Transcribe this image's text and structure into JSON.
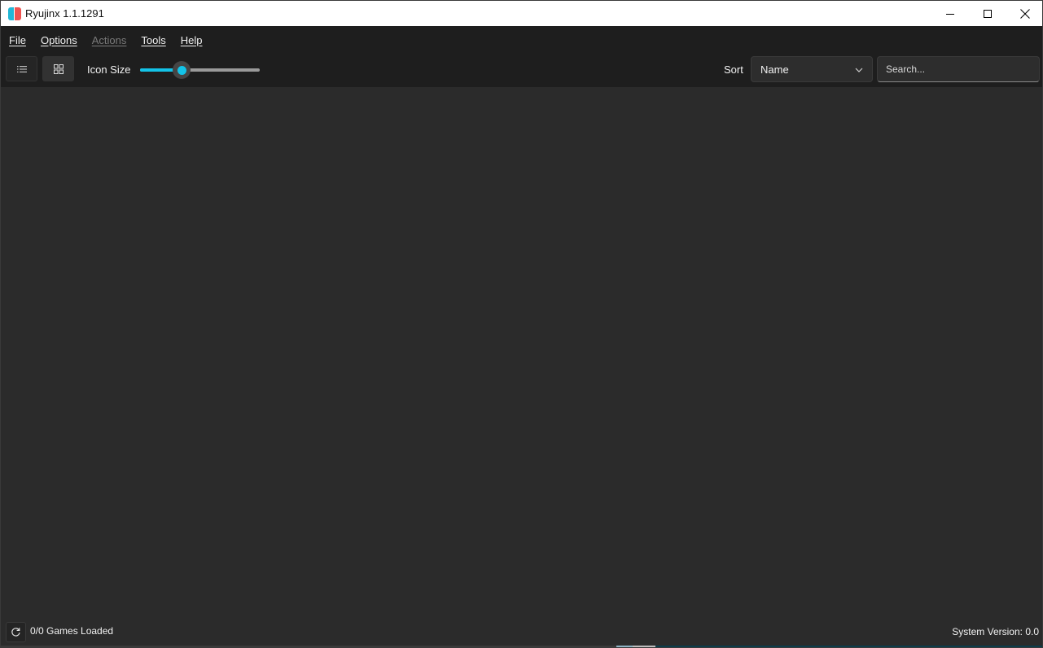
{
  "window": {
    "title": "Ryujinx 1.1.1291"
  },
  "menu": {
    "items": [
      {
        "label": "File",
        "enabled": true
      },
      {
        "label": "Options",
        "enabled": true
      },
      {
        "label": "Actions",
        "enabled": false
      },
      {
        "label": "Tools",
        "enabled": true
      },
      {
        "label": "Help",
        "enabled": true
      }
    ]
  },
  "toolbar": {
    "list_view_icon": "list-icon",
    "grid_view_icon": "grid-icon",
    "icon_size_label": "Icon Size",
    "icon_size_fraction": 0.35,
    "sort_label": "Sort",
    "sort_value": "Name",
    "search_placeholder": "Search...",
    "search_value": ""
  },
  "status": {
    "refresh_icon": "refresh-icon",
    "games_loaded": "0/0 Games Loaded",
    "system_version": "System Version: 0.0"
  },
  "colors": {
    "accent": "#13c3e8",
    "background": "#2b2b2b",
    "bar": "#1e1e1e"
  }
}
